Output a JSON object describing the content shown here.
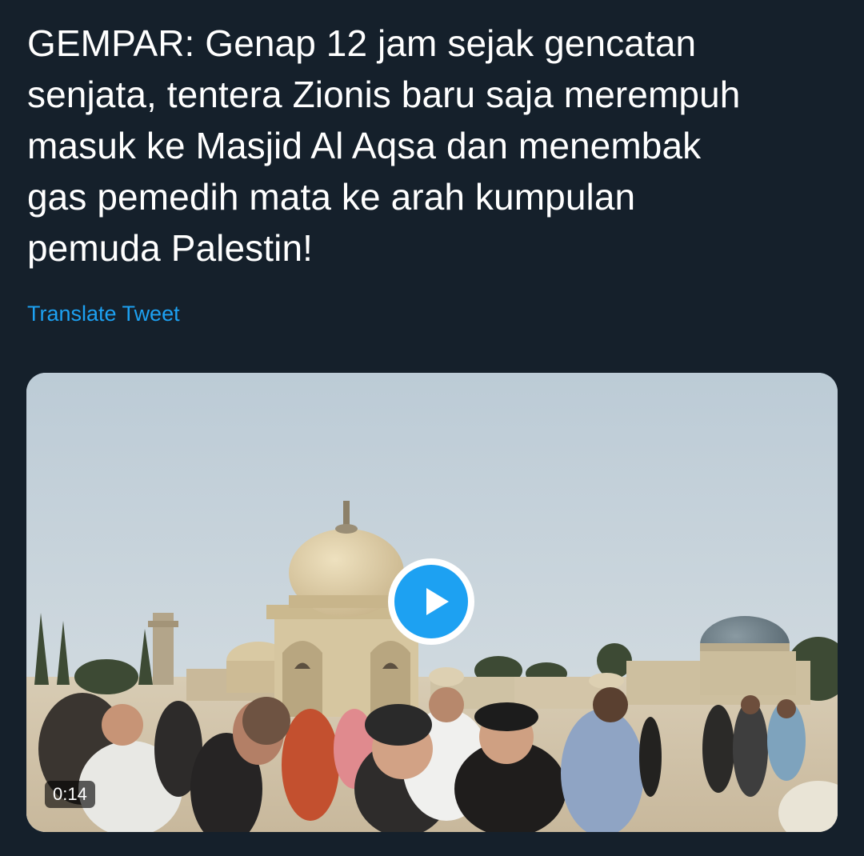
{
  "tweet": {
    "text": "GEMPAR: Genap 12 jam sejak gencatan\nsenjata, tentera Zionis baru saja merempuh\nmasuk ke Masjid Al Aqsa dan menembak\ngas pemedih mata ke arah kumpulan\npemuda Palestin!",
    "translate_label": "Translate Tweet"
  },
  "media": {
    "type": "video",
    "duration": "0:14",
    "play_icon": "play-icon"
  },
  "colors": {
    "background": "#15202b",
    "text": "#ffffff",
    "link": "#1da1f2",
    "play_button": "#1da1f2"
  }
}
